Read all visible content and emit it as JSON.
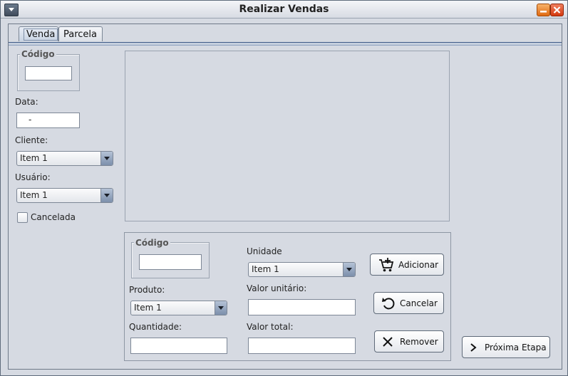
{
  "window": {
    "title": "Realizar Vendas"
  },
  "tabs": [
    {
      "label": "Venda",
      "active": true
    },
    {
      "label": "Parcela",
      "active": false
    }
  ],
  "left": {
    "codigo_legend": "Código",
    "codigo_value": "",
    "data_label": "Data:",
    "data_value": "-",
    "cliente_label": "Cliente:",
    "cliente_selected": "Item 1",
    "usuario_label": "Usuário:",
    "usuario_selected": "Item 1",
    "cancelada_label": "Cancelada",
    "cancelada_checked": false
  },
  "item": {
    "codigo_legend": "Código",
    "codigo_value": "",
    "produto_label": "Produto:",
    "produto_selected": "Item 1",
    "quantidade_label": "Quantidade:",
    "quantidade_value": "",
    "unidade_label": "Unidade",
    "unidade_selected": "Item 1",
    "valor_unitario_label": "Valor unitário:",
    "valor_unitario_value": "",
    "valor_total_label": "Valor total:",
    "valor_total_value": ""
  },
  "buttons": {
    "adicionar": "Adicionar",
    "cancelar": "Cancelar",
    "remover": "Remover",
    "proxima_etapa": "Próxima Etapa"
  },
  "icons": {
    "system_menu": "chevron-down-icon",
    "minimize": "minimize-icon",
    "close": "close-icon",
    "adicionar": "cart-plus-icon",
    "cancelar": "undo-icon",
    "remover": "x-icon",
    "proxima_etapa": "chevron-right-icon"
  }
}
